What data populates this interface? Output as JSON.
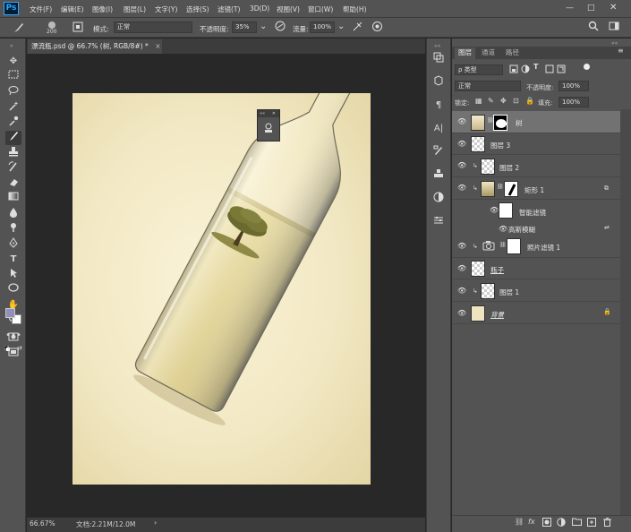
{
  "app": {
    "logo": "Ps"
  },
  "menu": [
    "文件(F)",
    "编辑(E)",
    "图像(I)",
    "图层(L)",
    "文字(Y)",
    "选择(S)",
    "滤镜(T)",
    "3D(D)",
    "视图(V)",
    "窗口(W)",
    "帮助(H)"
  ],
  "window_controls": {
    "min": "—",
    "max": "□",
    "close": "✕"
  },
  "options": {
    "brush_size": "200",
    "mode_label": "模式:",
    "mode_value": "正常",
    "opacity_label": "不透明度:",
    "opacity_value": "35%",
    "flow_label": "流量:",
    "flow_value": "100%"
  },
  "document": {
    "tab_title": "漂流瓶.psd @ 66.7% (树, RGB/8#) *",
    "close": "×"
  },
  "status": {
    "zoom": "66.67%",
    "doc": "文档:2.21M/12.0M",
    "arrow": "›"
  },
  "properties_popup": {
    "collapse": "««",
    "close": "✕"
  },
  "panel": {
    "tabs": [
      "图层",
      "通道",
      "路径"
    ],
    "filter_kind": "ρ 类型",
    "blend_mode": "正常",
    "opacity_label": "不透明度:",
    "opacity_value": "100%",
    "lock_label": "锁定:",
    "fill_label": "填充:",
    "fill_value": "100%"
  },
  "layers": [
    {
      "name": "树",
      "selected": true
    },
    {
      "name": "图层 3"
    },
    {
      "name": "图层 2"
    },
    {
      "name": "矩形 1"
    },
    {
      "name": "智能滤镜"
    },
    {
      "name": "高斯模糊"
    },
    {
      "name": "照片滤镜 1"
    },
    {
      "name": "瓶子"
    },
    {
      "name": "图层 1"
    },
    {
      "name": "背景"
    }
  ],
  "colors": {
    "accent": "#31a8ff",
    "panel_bg": "#535353",
    "canvas_bg": "#282828",
    "artboard": "#f2e8c4",
    "selected_row": "#727272"
  }
}
